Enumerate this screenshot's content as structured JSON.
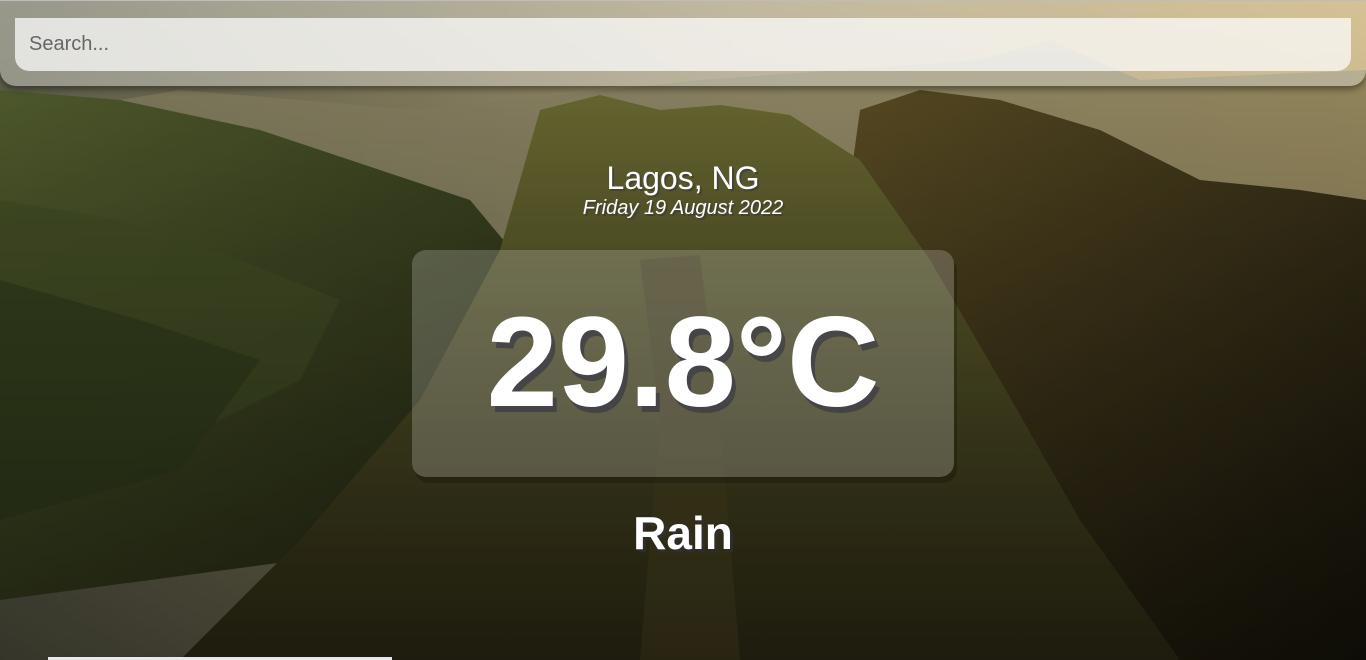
{
  "search": {
    "placeholder": "Search...",
    "value": ""
  },
  "location": {
    "city_country": "Lagos, NG",
    "date": "Friday 19 August 2022"
  },
  "weather": {
    "temperature": "29.8°C",
    "condition": "Rain"
  },
  "colors": {
    "text": "#ffffff",
    "overlay_box": "rgba(255,255,255,0.2)",
    "search_bar": "rgba(255,255,255,0.72)"
  }
}
